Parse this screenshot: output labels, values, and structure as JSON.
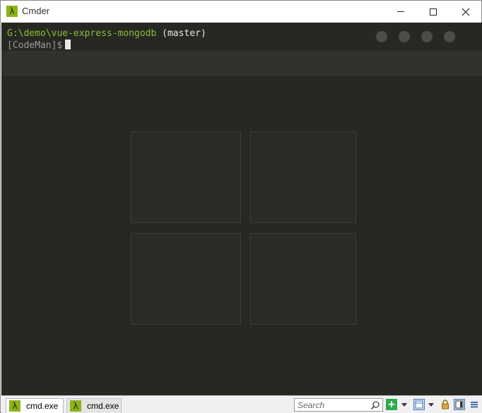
{
  "window": {
    "title": "Cmder",
    "app_icon_glyph": "λ",
    "controls": [
      "minimize",
      "maximize",
      "close"
    ]
  },
  "terminal": {
    "line1_path": "G:\\demo\\vue-express-mongodb",
    "line1_branch": " (master)",
    "line2_prompt": "[CodeMan]$"
  },
  "statusbar": {
    "tabs": [
      {
        "label": "cmd.exe",
        "icon": "λ",
        "active": true
      },
      {
        "label": "cmd.exe",
        "icon": "λ",
        "active": false
      }
    ],
    "search_placeholder": "Search",
    "add_button_glyph": "+"
  },
  "colors": {
    "terminal_bg": "#272822",
    "path_green": "#8cbd3a",
    "cmder_icon": "#8cb31b",
    "add_button": "#2fa84f"
  }
}
